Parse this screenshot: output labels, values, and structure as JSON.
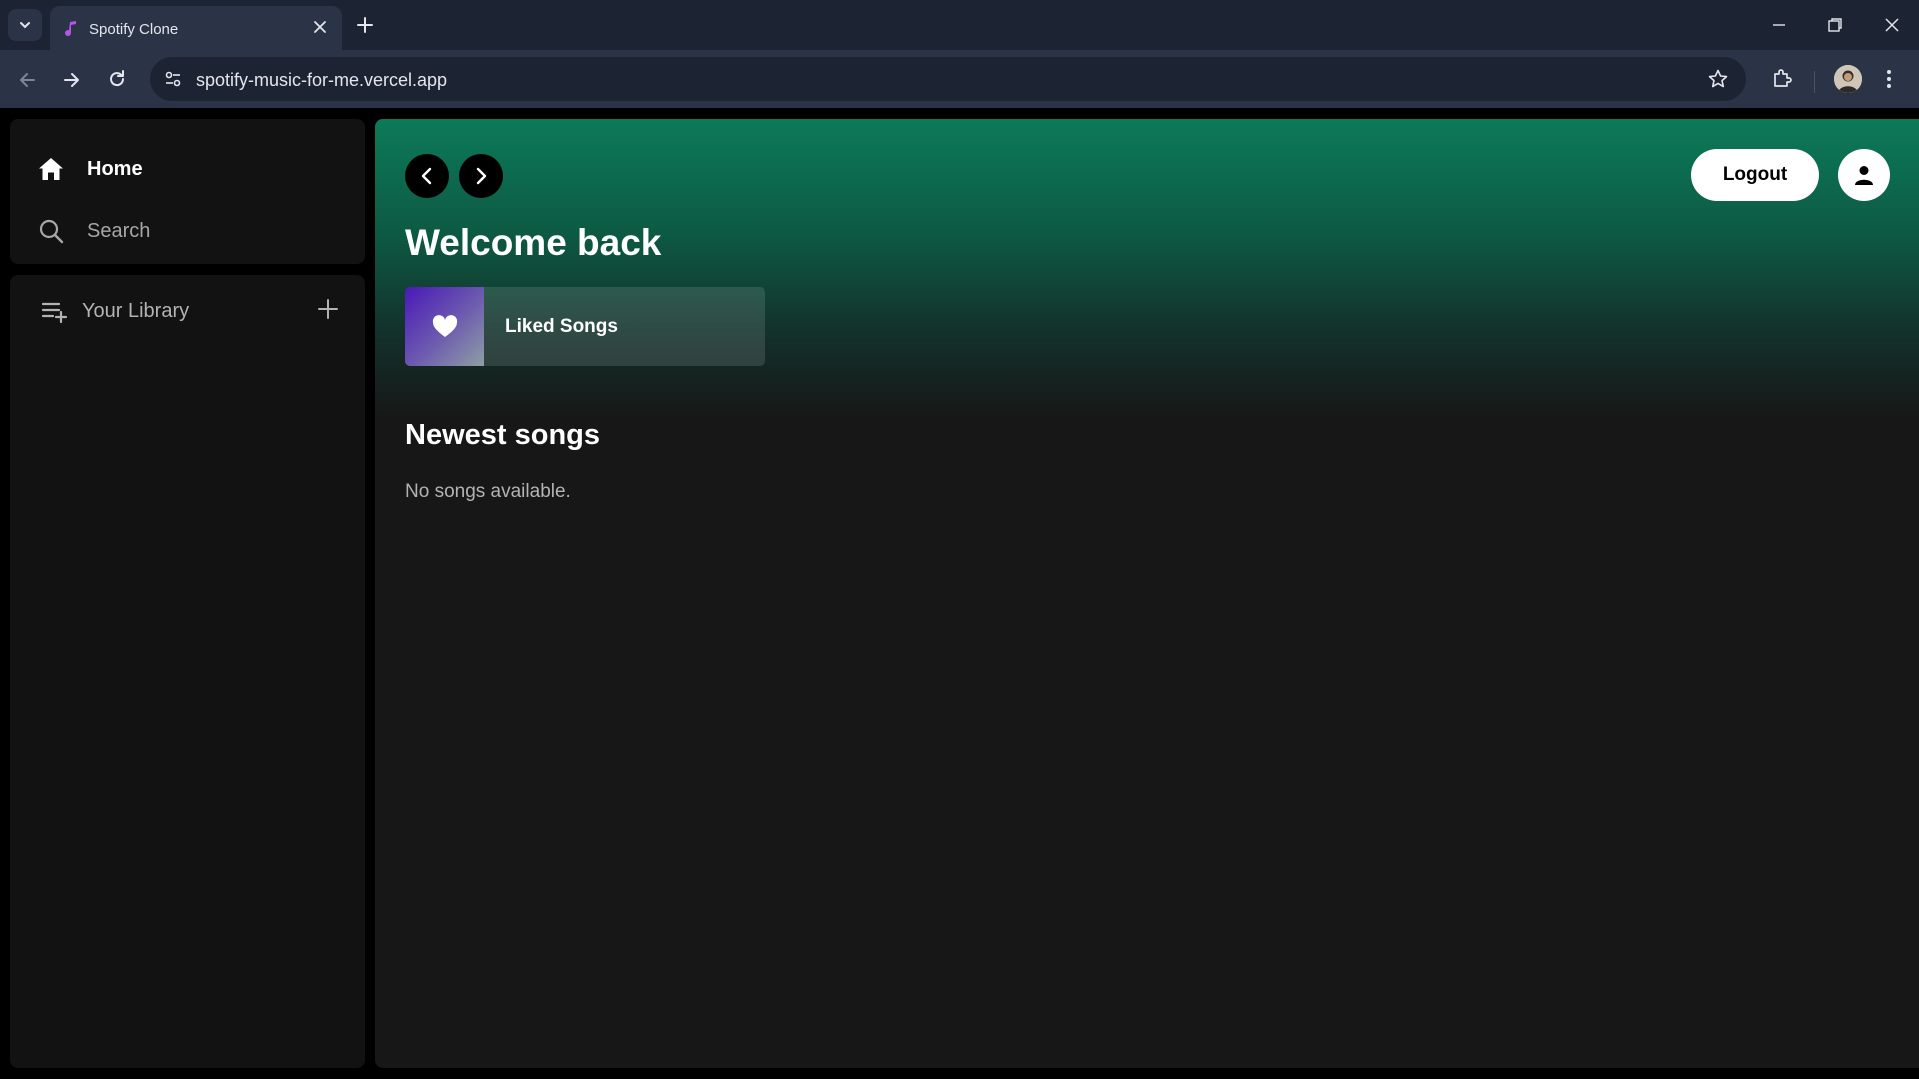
{
  "browser": {
    "tab_title": "Spotify Clone",
    "url": "spotify-music-for-me.vercel.app"
  },
  "sidebar": {
    "nav": [
      {
        "label": "Home",
        "icon": "home-icon",
        "active": true
      },
      {
        "label": "Search",
        "icon": "search-icon",
        "active": false
      }
    ],
    "library": {
      "label": "Your Library",
      "icon": "library-icon",
      "add_icon": "plus-icon"
    }
  },
  "header": {
    "logout_label": "Logout",
    "user_icon": "user-icon",
    "back_icon": "chevron-left-icon",
    "forward_icon": "chevron-right-icon"
  },
  "main": {
    "greeting": "Welcome back",
    "liked_card": {
      "title": "Liked Songs",
      "icon": "heart-icon"
    },
    "newest": {
      "title": "Newest songs",
      "empty_message": "No songs available."
    }
  },
  "colors": {
    "accent_gradient_top": "#0c7a58",
    "background": "#121212",
    "main_background": "#171717"
  }
}
